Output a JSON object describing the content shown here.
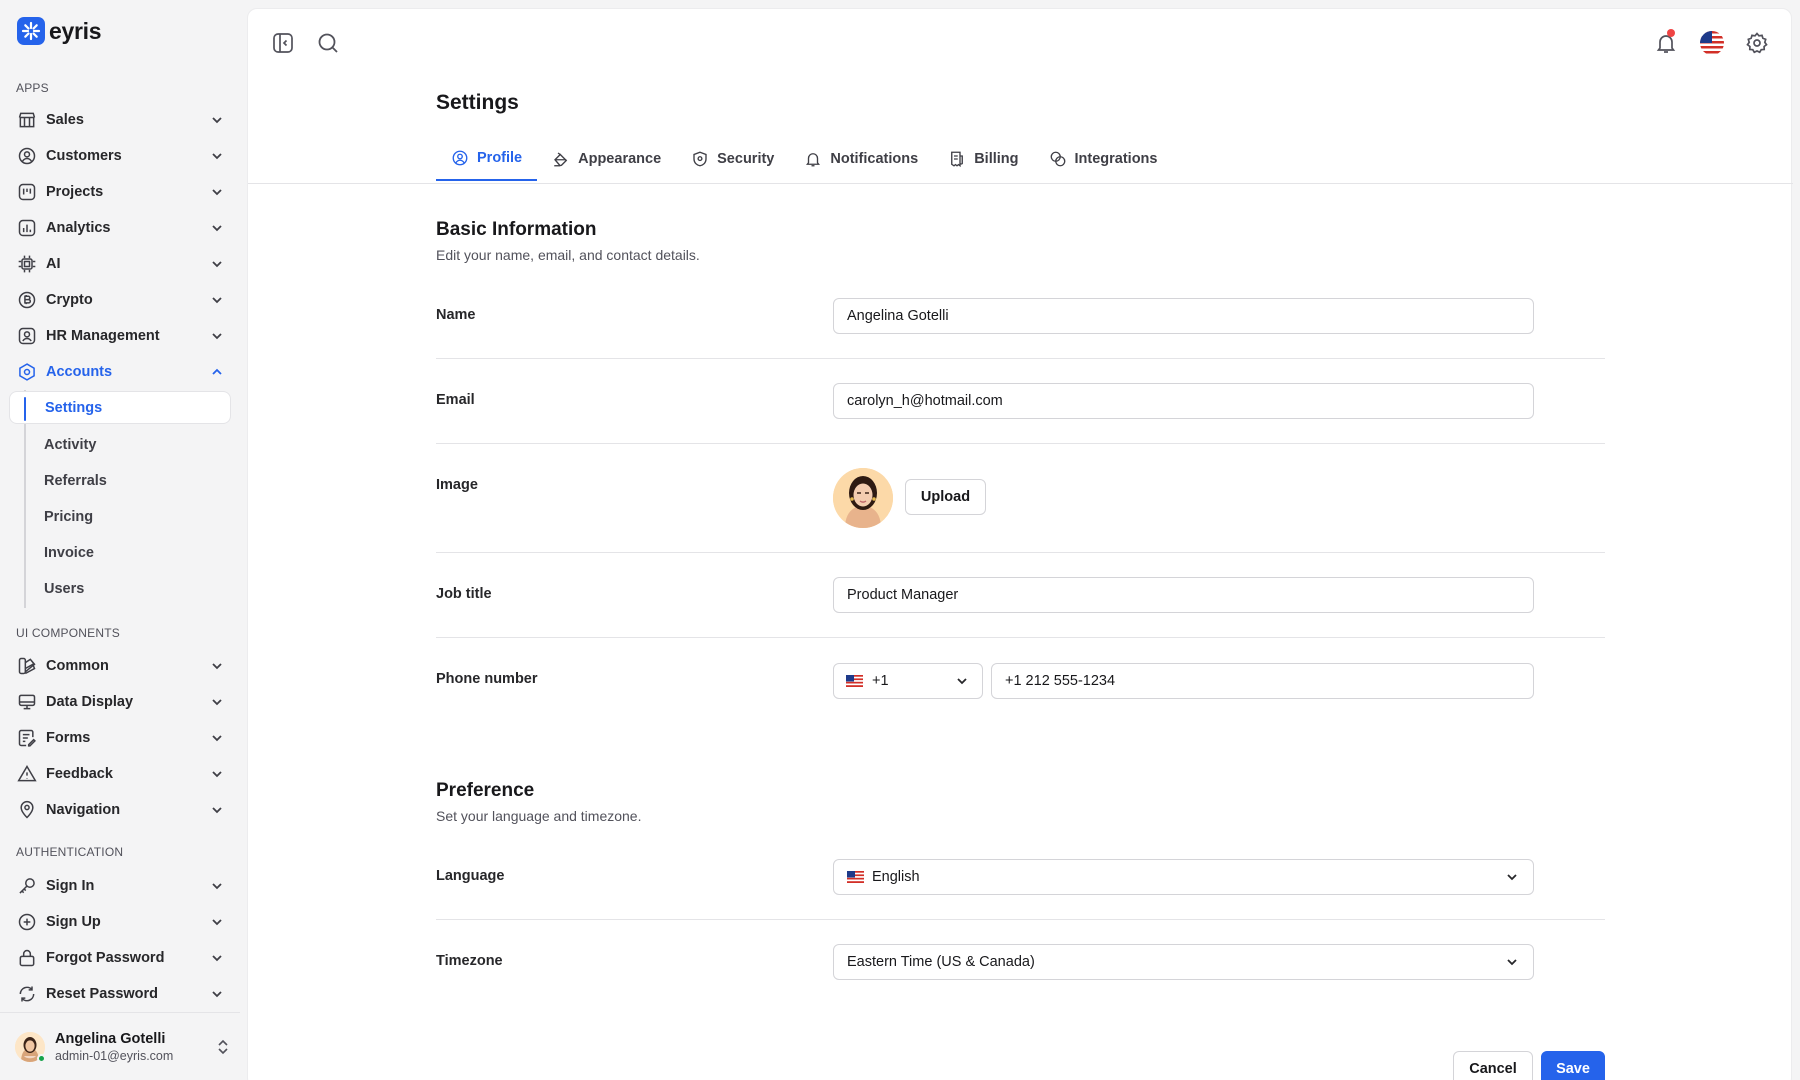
{
  "brand": {
    "name": "eyris"
  },
  "sidebar": {
    "sections": {
      "apps": "APPS",
      "ui": "UI COMPONENTS",
      "auth": "AUTHENTICATION"
    },
    "apps": [
      {
        "label": "Sales",
        "icon": "storefront-icon"
      },
      {
        "label": "Customers",
        "icon": "user-circle-icon"
      },
      {
        "label": "Projects",
        "icon": "project-board-icon"
      },
      {
        "label": "Analytics",
        "icon": "bar-chart-icon"
      },
      {
        "label": "AI",
        "icon": "chip-icon"
      },
      {
        "label": "Crypto",
        "icon": "bitcoin-icon"
      },
      {
        "label": "HR Management",
        "icon": "id-badge-icon"
      },
      {
        "label": "Accounts",
        "icon": "hexagon-user-icon"
      }
    ],
    "account_sub": [
      {
        "label": "Settings"
      },
      {
        "label": "Activity"
      },
      {
        "label": "Referrals"
      },
      {
        "label": "Pricing"
      },
      {
        "label": "Invoice"
      },
      {
        "label": "Users"
      }
    ],
    "ui": [
      {
        "label": "Common",
        "icon": "shapes-icon"
      },
      {
        "label": "Data Display",
        "icon": "monitor-icon"
      },
      {
        "label": "Forms",
        "icon": "form-icon"
      },
      {
        "label": "Feedback",
        "icon": "warning-triangle-icon"
      },
      {
        "label": "Navigation",
        "icon": "map-pin-icon"
      }
    ],
    "auth": [
      {
        "label": "Sign In",
        "icon": "key-icon"
      },
      {
        "label": "Sign Up",
        "icon": "plus-circle-icon"
      },
      {
        "label": "Forgot Password",
        "icon": "lock-icon"
      },
      {
        "label": "Reset Password",
        "icon": "refresh-icon"
      }
    ],
    "user": {
      "name": "Angelina Gotelli",
      "email": "admin-01@eyris.com"
    }
  },
  "page": {
    "title": "Settings",
    "tabs": [
      {
        "label": "Profile",
        "icon": "user-circle-icon"
      },
      {
        "label": "Appearance",
        "icon": "paint-bucket-icon"
      },
      {
        "label": "Security",
        "icon": "shield-icon"
      },
      {
        "label": "Notifications",
        "icon": "bell-icon"
      },
      {
        "label": "Billing",
        "icon": "receipt-icon"
      },
      {
        "label": "Integrations",
        "icon": "integrations-icon"
      }
    ]
  },
  "basic": {
    "title": "Basic Information",
    "desc": "Edit your name, email, and contact details.",
    "name_label": "Name",
    "name_value": "Angelina Gotelli",
    "email_label": "Email",
    "email_value": "carolyn_h@hotmail.com",
    "image_label": "Image",
    "upload_label": "Upload",
    "job_label": "Job title",
    "job_value": "Product Manager",
    "phone_label": "Phone number",
    "phone_code": "+1",
    "phone_value": "+1 212 555-1234"
  },
  "preference": {
    "title": "Preference",
    "desc": "Set your language and timezone.",
    "language_label": "Language",
    "language_value": "English",
    "timezone_label": "Timezone",
    "timezone_value": "Eastern Time (US & Canada)"
  },
  "actions": {
    "cancel": "Cancel",
    "save": "Save"
  },
  "colors": {
    "accent": "#2563eb",
    "notification": "#ef4444",
    "online": "#16a34a"
  }
}
